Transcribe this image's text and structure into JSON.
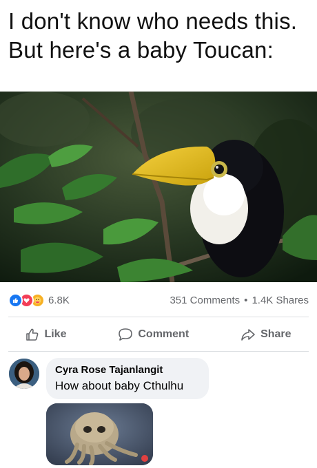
{
  "caption": {
    "line1": "I don't know who needs this.",
    "line2": "But here's a baby Toucan:"
  },
  "post": {
    "reaction_icons": [
      "like-icon",
      "love-icon",
      "care-icon"
    ],
    "reaction_count": "6.8K",
    "comments": "351 Comments",
    "separator": "•",
    "shares": "1.4K Shares"
  },
  "actions": {
    "like": "Like",
    "comment": "Comment",
    "share": "Share"
  },
  "comment": {
    "author": "Cyra Rose Tajanlangit",
    "text": "How about baby Cthulhu"
  },
  "colors": {
    "like_blue": "#1877f2",
    "love_red": "#f33e58",
    "care_yellow": "#f7b125",
    "muted_text": "#65676b",
    "bubble_bg": "#f0f2f5"
  }
}
